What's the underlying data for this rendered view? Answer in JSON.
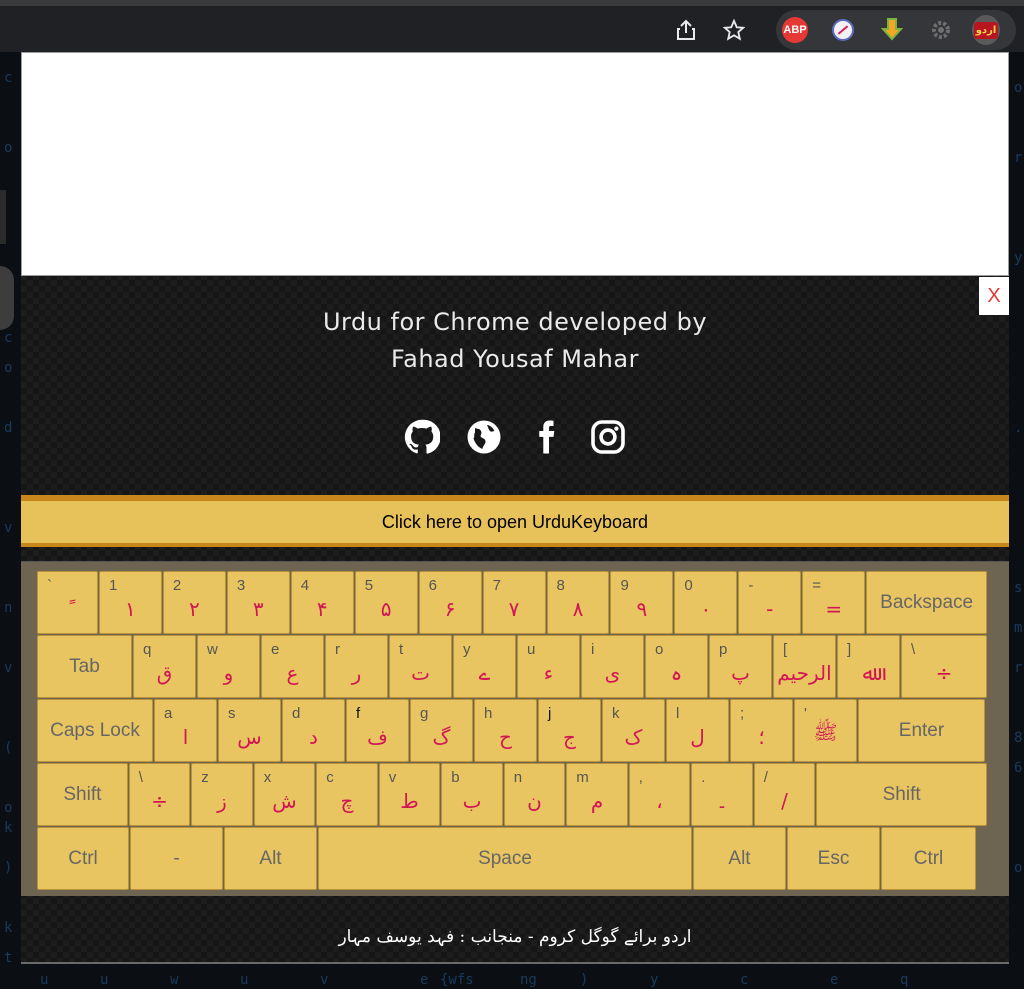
{
  "browser": {
    "toolbar_icons": [
      "share-icon",
      "star-icon"
    ],
    "extensions": [
      {
        "name": "adblock-plus-icon",
        "label": "ABP"
      },
      {
        "name": "noscript-icon"
      },
      {
        "name": "download-arrow-icon"
      },
      {
        "name": "gear-extension-icon"
      },
      {
        "name": "urdu-extension-icon",
        "label": "اردو"
      }
    ]
  },
  "popup": {
    "close_label": "X",
    "credit_line1": "Urdu for Chrome developed by",
    "credit_line2": "Fahad Yousaf Mahar",
    "social_icons": [
      "github-icon",
      "globe-icon",
      "facebook-icon",
      "instagram-icon"
    ],
    "open_keyboard_label": "Click here to open UrduKeyboard",
    "footer_text": "اردو برائے گوگل کروم - منجانب : فہد یوسف مہار"
  },
  "keyboard": {
    "rows": [
      [
        {
          "lat": "`",
          "urd": "ً"
        },
        {
          "lat": "1",
          "urd": "۱"
        },
        {
          "lat": "2",
          "urd": "۲"
        },
        {
          "lat": "3",
          "urd": "۳"
        },
        {
          "lat": "4",
          "urd": "۴"
        },
        {
          "lat": "5",
          "urd": "۵"
        },
        {
          "lat": "6",
          "urd": "۶"
        },
        {
          "lat": "7",
          "urd": "۷"
        },
        {
          "lat": "8",
          "urd": "۸"
        },
        {
          "lat": "9",
          "urd": "۹"
        },
        {
          "lat": "0",
          "urd": "۰"
        },
        {
          "lat": "-",
          "urd": "-"
        },
        {
          "lat": "=",
          "urd": "="
        },
        {
          "fn": "Backspace"
        }
      ],
      [
        {
          "fn": "Tab"
        },
        {
          "lat": "q",
          "urd": "ق"
        },
        {
          "lat": "w",
          "urd": "و"
        },
        {
          "lat": "e",
          "urd": "ع"
        },
        {
          "lat": "r",
          "urd": "ر"
        },
        {
          "lat": "t",
          "urd": "ت"
        },
        {
          "lat": "y",
          "urd": "ے"
        },
        {
          "lat": "u",
          "urd": "ء"
        },
        {
          "lat": "i",
          "urd": "ی"
        },
        {
          "lat": "o",
          "urd": "ہ"
        },
        {
          "lat": "p",
          "urd": "پ"
        },
        {
          "lat": "[",
          "urd": "الرحیم"
        },
        {
          "lat": "]",
          "urd": "ﷲ"
        },
        {
          "lat": "\\",
          "urd": "÷"
        }
      ],
      [
        {
          "fn": "Caps Lock"
        },
        {
          "lat": "a",
          "urd": "ا"
        },
        {
          "lat": "s",
          "urd": "س"
        },
        {
          "lat": "d",
          "urd": "د"
        },
        {
          "lat": "f",
          "urd": "ف",
          "dark": true
        },
        {
          "lat": "g",
          "urd": "گ"
        },
        {
          "lat": "h",
          "urd": "ح"
        },
        {
          "lat": "j",
          "urd": "ج",
          "dark": true
        },
        {
          "lat": "k",
          "urd": "ک"
        },
        {
          "lat": "l",
          "urd": "ل"
        },
        {
          "lat": ";",
          "urd": "؛"
        },
        {
          "lat": "'",
          "urd": "ﷺ"
        },
        {
          "fn": "Enter"
        }
      ],
      [
        {
          "fn": "Shift"
        },
        {
          "lat": "\\",
          "urd": "÷"
        },
        {
          "lat": "z",
          "urd": "ز"
        },
        {
          "lat": "x",
          "urd": "ش"
        },
        {
          "lat": "c",
          "urd": "چ"
        },
        {
          "lat": "v",
          "urd": "ط"
        },
        {
          "lat": "b",
          "urd": "ب"
        },
        {
          "lat": "n",
          "urd": "ن"
        },
        {
          "lat": "m",
          "urd": "م"
        },
        {
          "lat": ",",
          "urd": "،"
        },
        {
          "lat": ".",
          "urd": "۔"
        },
        {
          "lat": "/",
          "urd": "/"
        },
        {
          "fn": "Shift"
        }
      ],
      [
        {
          "fn": "Ctrl"
        },
        {
          "fn": "-"
        },
        {
          "fn": "Alt"
        },
        {
          "fn": "Space"
        },
        {
          "fn": "Alt"
        },
        {
          "fn": "Esc"
        },
        {
          "fn": "Ctrl"
        }
      ]
    ]
  }
}
